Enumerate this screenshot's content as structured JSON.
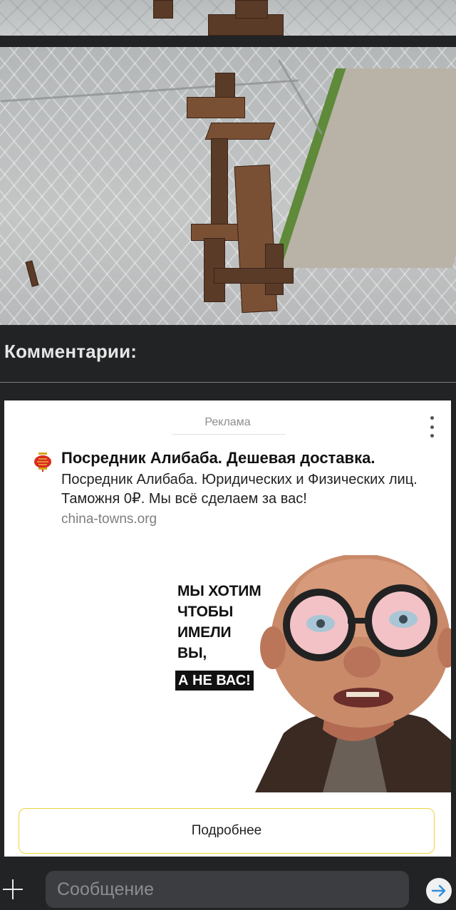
{
  "comments": {
    "title": "Комментарии:"
  },
  "ad": {
    "label": "Реклама",
    "title": "Посредник Алибаба. Дешевая доставка.",
    "description": "Посредник Алибаба. Юридических и Физических лиц. Таможня 0₽. Мы всё сделаем за вас!",
    "domain": "china-towns.org",
    "image_text_lines": [
      "МЫ ХОТИМ",
      "ЧТОБЫ",
      "ИМЕЛИ",
      "ВЫ,"
    ],
    "image_text_highlight": "А НЕ ВАС!",
    "button_label": "Подробнее",
    "favicon_icon": "lantern-icon",
    "menu_icon": "kebab-menu-icon",
    "button_border_color": "#f0d53a"
  },
  "composer": {
    "placeholder": "Сообщение",
    "add_icon": "plus-icon",
    "send_icon": "arrow-right-icon",
    "send_icon_color": "#2f8fdc"
  },
  "colors": {
    "background": "#222325",
    "text": "#e6e6e6"
  }
}
